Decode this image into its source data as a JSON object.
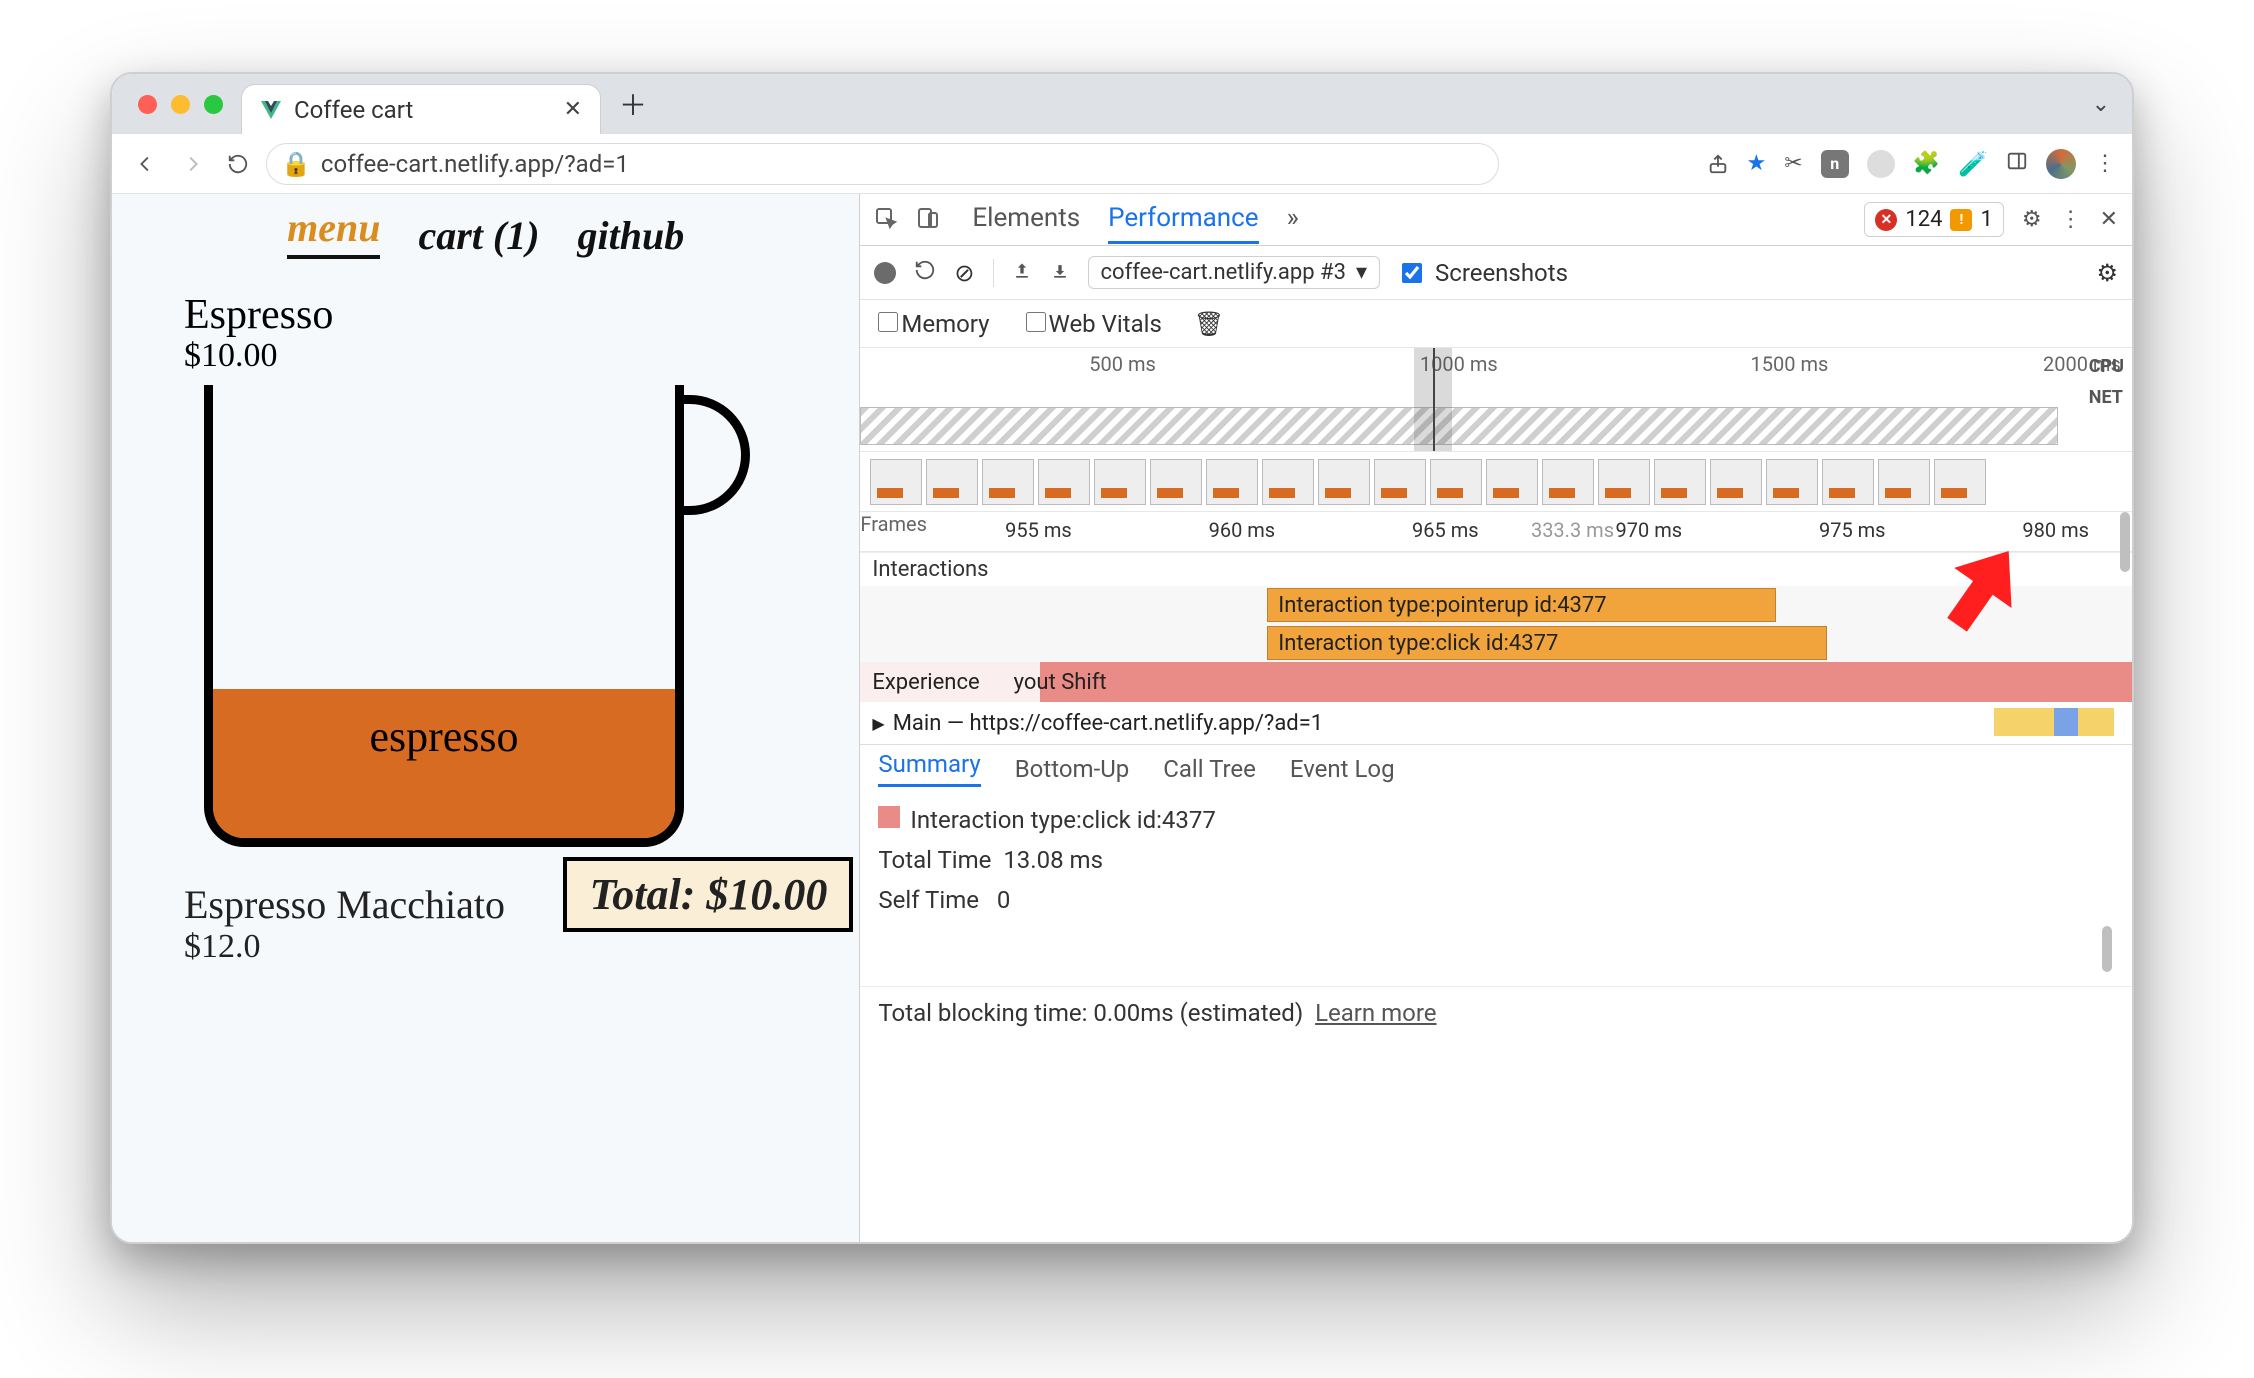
{
  "browser": {
    "tab_title": "Coffee cart",
    "url_display": "coffee-cart.netlify.app/?ad=1"
  },
  "site_nav": {
    "menu": "menu",
    "cart": "cart (1)",
    "github": "github"
  },
  "items": [
    {
      "name": "Espresso",
      "price": "$10.00",
      "fill_label": "espresso"
    },
    {
      "name": "Espresso Macchiato",
      "price": "$12.0"
    }
  ],
  "total_chip": "Total: $10.00",
  "devtools": {
    "tabs": {
      "elements": "Elements",
      "performance": "Performance"
    },
    "errors": "124",
    "warnings": "1",
    "recording_select": "coffee-cart.netlify.app #3",
    "screenshots_label": "Screenshots",
    "memory_label": "Memory",
    "webvitals_label": "Web Vitals",
    "overview_ticks": [
      "500 ms",
      "1000 ms",
      "1500 ms",
      "2000 ms"
    ],
    "ov_right": {
      "cpu": "CPU",
      "net": "NET"
    },
    "ruler": {
      "frames": "Frames",
      "mid": "333.3 ms",
      "ticks": [
        "955 ms",
        "960 ms",
        "965 ms",
        "970 ms",
        "975 ms",
        "980 ms"
      ]
    },
    "interactions_head": "Interactions",
    "bars": {
      "pointerup": "Interaction type:pointerup id:4377",
      "click": "Interaction type:click id:4377"
    },
    "experience_row": "Experience",
    "experience_shift": "yout Shift",
    "main_row": "Main — https://coffee-cart.netlify.app/?ad=1",
    "bottom_tabs": {
      "summary": "Summary",
      "bottomup": "Bottom-Up",
      "calltree": "Call Tree",
      "eventlog": "Event Log"
    },
    "summary": {
      "title": "Interaction type:click id:4377",
      "total_label": "Total Time",
      "total_value": "13.08 ms",
      "self_label": "Self Time",
      "self_value": "0"
    },
    "status": {
      "text": "Total blocking time: 0.00ms (estimated)",
      "link": "Learn more"
    }
  }
}
